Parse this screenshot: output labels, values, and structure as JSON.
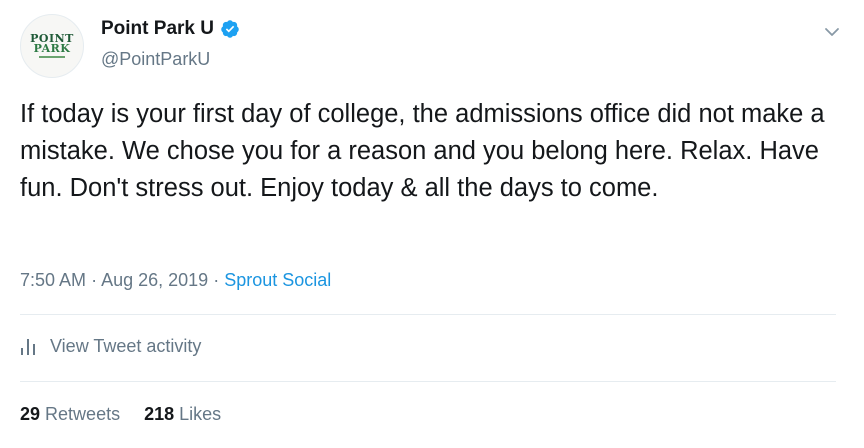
{
  "author": {
    "avatar_text_line1": "POINT",
    "avatar_text_line2": "PARK",
    "display_name": "Point Park U",
    "handle": "@PointParkU",
    "verified_icon": "verified-badge-icon"
  },
  "tweet": {
    "text": "If today is your first day of college, the admissions office did not make a mistake. We chose you for a reason and you belong here. Relax. Have fun. Don't stress out. Enjoy today & all the days to come.",
    "time": "7:50 AM",
    "separator": "·",
    "date": "Aug 26, 2019",
    "source": "Sprout Social"
  },
  "activity": {
    "label": "View Tweet activity",
    "icon": "bar-chart-icon"
  },
  "stats": {
    "retweets_count": "29",
    "retweets_label": "Retweets",
    "likes_count": "218",
    "likes_label": "Likes"
  },
  "colors": {
    "text_primary": "#14171a",
    "text_secondary": "#657786",
    "link_blue": "#1b95e0",
    "divider": "#e6ecf0",
    "verified_blue": "#1da1f2"
  }
}
